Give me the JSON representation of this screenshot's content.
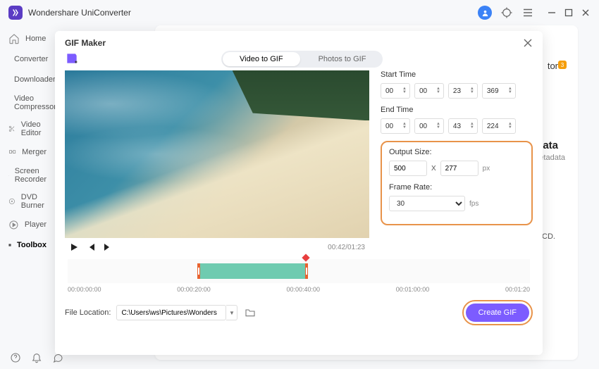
{
  "app": {
    "title": "Wondershare UniConverter"
  },
  "sidebar": {
    "items": [
      {
        "label": "Home"
      },
      {
        "label": "Converter"
      },
      {
        "label": "Downloader"
      },
      {
        "label": "Video Compressor"
      },
      {
        "label": "Video Editor"
      },
      {
        "label": "Merger"
      },
      {
        "label": "Screen Recorder"
      },
      {
        "label": "DVD Burner"
      },
      {
        "label": "Player"
      },
      {
        "label": "Toolbox"
      }
    ]
  },
  "bg": {
    "tor": "tor",
    "badge": "3",
    "meta_h": "data",
    "meta_s": "etadata",
    "cd": "CD."
  },
  "modal": {
    "title": "GIF Maker",
    "tabs": {
      "video": "Video to GIF",
      "photos": "Photos to GIF"
    },
    "time": {
      "start_lbl": "Start Time",
      "end_lbl": "End Time",
      "start": {
        "h": "00",
        "m": "00",
        "s": "23",
        "ms": "369"
      },
      "end": {
        "h": "00",
        "m": "00",
        "s": "43",
        "ms": "224"
      }
    },
    "output": {
      "size_lbl": "Output Size:",
      "w": "500",
      "x": "X",
      "h": "277",
      "unit": "px",
      "fr_lbl": "Frame Rate:",
      "fr": "30",
      "fr_unit": "fps"
    },
    "preview": {
      "current": "00:42",
      "total": "01:23"
    },
    "timeline": {
      "ticks": [
        "00:00:00:00",
        "00:00:20:00",
        "00:00:40:00",
        "00:01:00:00",
        "00:01:20"
      ],
      "sel_left_pct": 28,
      "sel_width_pct": 24,
      "play_pct": 51.5
    },
    "file": {
      "lbl": "File Location:",
      "path": "C:\\Users\\ws\\Pictures\\Wonders"
    },
    "create": "Create GIF"
  }
}
